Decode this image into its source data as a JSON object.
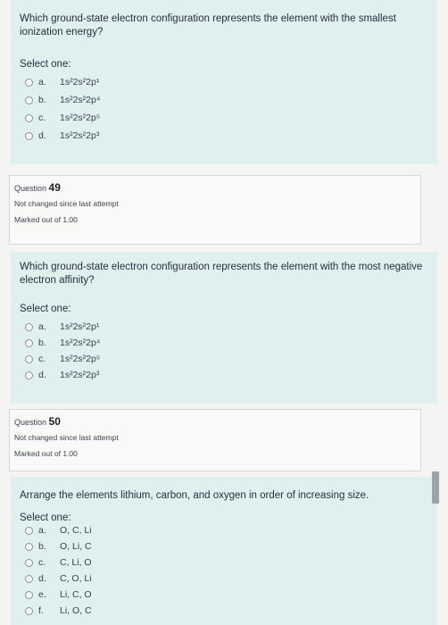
{
  "q1": {
    "text": "Which ground-state electron configuration represents the element with the smallest ionization energy?",
    "select_label": "Select one:",
    "options": [
      {
        "letter": "a.",
        "text": "1s²2s²2p¹"
      },
      {
        "letter": "b.",
        "text": "1s²2s²2p⁴"
      },
      {
        "letter": "c.",
        "text": "1s²2s²2p⁵"
      },
      {
        "letter": "d.",
        "text": "1s²2s²2p³"
      }
    ]
  },
  "info49": {
    "label": "Question",
    "number": "49",
    "status": "Not changed since last attempt",
    "marked": "Marked out of 1.00"
  },
  "q2": {
    "text": "Which ground-state electron configuration represents the element with the most negative electron affinity?",
    "select_label": "Select one:",
    "options": [
      {
        "letter": "a.",
        "text": "1s²2s²2p¹"
      },
      {
        "letter": "b.",
        "text": "1s²2s²2p⁴"
      },
      {
        "letter": "c.",
        "text": "1s²2s²2p⁵"
      },
      {
        "letter": "d.",
        "text": "1s²2s²2p³"
      }
    ]
  },
  "info50": {
    "label": "Question",
    "number": "50",
    "status": "Not changed since last attempt",
    "marked": "Marked out of 1.00"
  },
  "q3": {
    "text": "Arrange the elements lithium, carbon, and oxygen in order of increasing size.",
    "select_label": "Select one:",
    "options": [
      {
        "letter": "a.",
        "text": "O, C, Li"
      },
      {
        "letter": "b.",
        "text": "O, Li, C"
      },
      {
        "letter": "c.",
        "text": "C, Li, O"
      },
      {
        "letter": "d.",
        "text": "C, O, Li"
      },
      {
        "letter": "e.",
        "text": "Li, C, O"
      },
      {
        "letter": "f.",
        "text": "Li, O, C"
      }
    ]
  }
}
